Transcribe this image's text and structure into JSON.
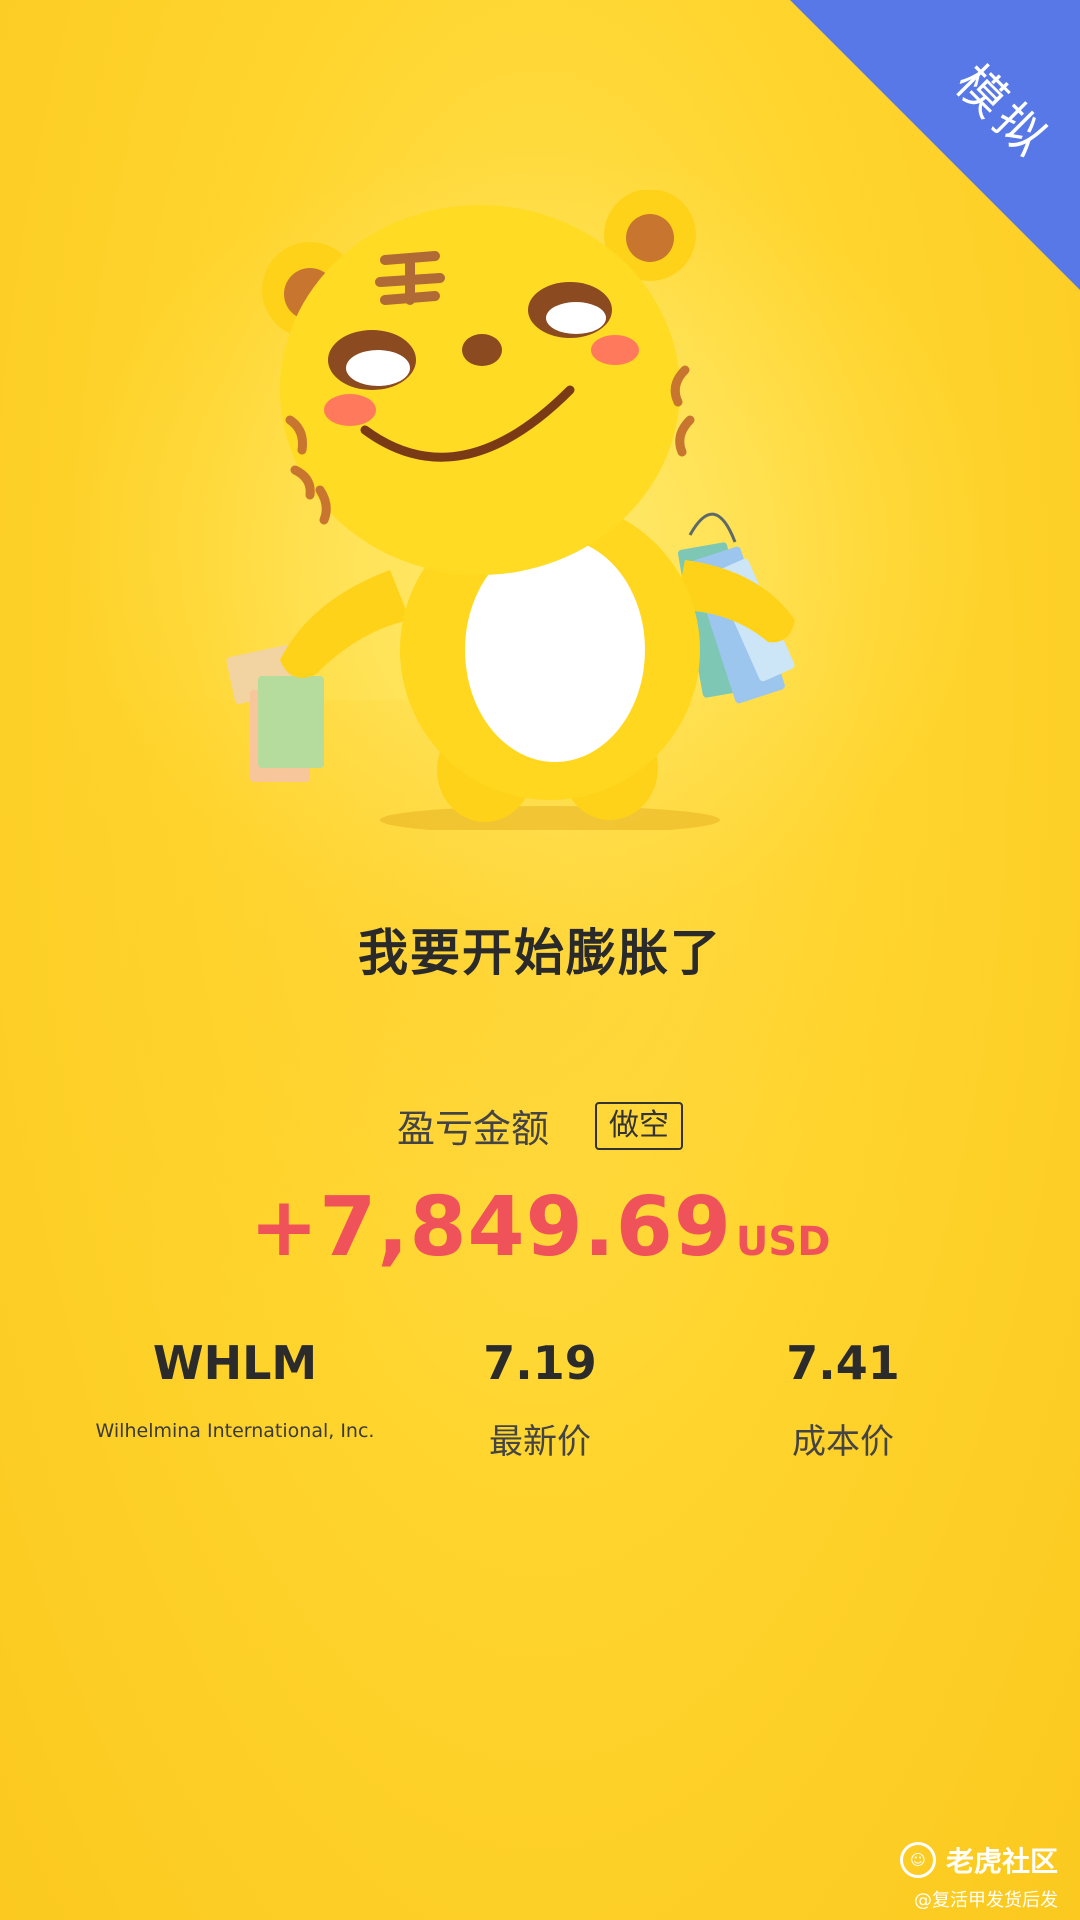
{
  "corner_badge": {
    "label": "模拟",
    "color": "#5878e8"
  },
  "mascot": {
    "name": "tiger-mascot"
  },
  "headline": "我要开始膨胀了",
  "pnl": {
    "label": "盈亏金额",
    "direction_tag": "做空",
    "amount": "+7,849.69",
    "currency": "USD",
    "color": "#f0525a"
  },
  "stats": {
    "symbol": "WHLM",
    "company": "Wilhelmina International, Inc.",
    "latest_price": "7.19",
    "latest_price_label": "最新价",
    "cost_price": "7.41",
    "cost_price_label": "成本价"
  },
  "watermark": {
    "brand": "老虎社区",
    "user": "@复活甲发货后发"
  }
}
